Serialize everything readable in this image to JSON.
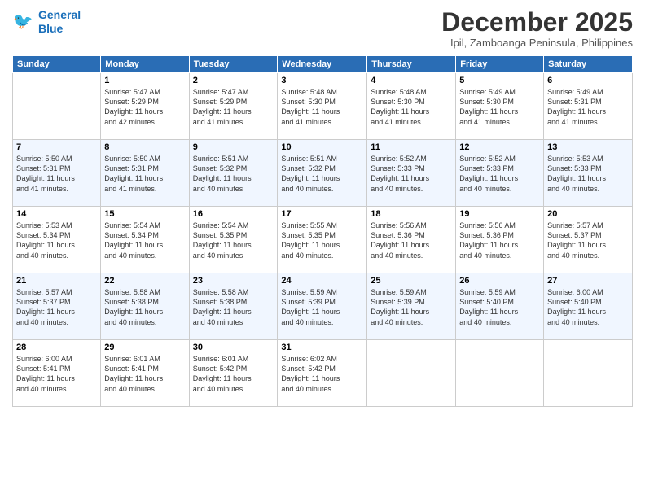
{
  "logo": {
    "line1": "General",
    "line2": "Blue"
  },
  "title": "December 2025",
  "location": "Ipil, Zamboanga Peninsula, Philippines",
  "days_of_week": [
    "Sunday",
    "Monday",
    "Tuesday",
    "Wednesday",
    "Thursday",
    "Friday",
    "Saturday"
  ],
  "weeks": [
    [
      {
        "day": "",
        "sunrise": "",
        "sunset": "",
        "daylight": ""
      },
      {
        "day": "1",
        "sunrise": "Sunrise: 5:47 AM",
        "sunset": "Sunset: 5:29 PM",
        "daylight": "Daylight: 11 hours and 42 minutes."
      },
      {
        "day": "2",
        "sunrise": "Sunrise: 5:47 AM",
        "sunset": "Sunset: 5:29 PM",
        "daylight": "Daylight: 11 hours and 41 minutes."
      },
      {
        "day": "3",
        "sunrise": "Sunrise: 5:48 AM",
        "sunset": "Sunset: 5:30 PM",
        "daylight": "Daylight: 11 hours and 41 minutes."
      },
      {
        "day": "4",
        "sunrise": "Sunrise: 5:48 AM",
        "sunset": "Sunset: 5:30 PM",
        "daylight": "Daylight: 11 hours and 41 minutes."
      },
      {
        "day": "5",
        "sunrise": "Sunrise: 5:49 AM",
        "sunset": "Sunset: 5:30 PM",
        "daylight": "Daylight: 11 hours and 41 minutes."
      },
      {
        "day": "6",
        "sunrise": "Sunrise: 5:49 AM",
        "sunset": "Sunset: 5:31 PM",
        "daylight": "Daylight: 11 hours and 41 minutes."
      }
    ],
    [
      {
        "day": "7",
        "sunrise": "Sunrise: 5:50 AM",
        "sunset": "Sunset: 5:31 PM",
        "daylight": "Daylight: 11 hours and 41 minutes."
      },
      {
        "day": "8",
        "sunrise": "Sunrise: 5:50 AM",
        "sunset": "Sunset: 5:31 PM",
        "daylight": "Daylight: 11 hours and 41 minutes."
      },
      {
        "day": "9",
        "sunrise": "Sunrise: 5:51 AM",
        "sunset": "Sunset: 5:32 PM",
        "daylight": "Daylight: 11 hours and 40 minutes."
      },
      {
        "day": "10",
        "sunrise": "Sunrise: 5:51 AM",
        "sunset": "Sunset: 5:32 PM",
        "daylight": "Daylight: 11 hours and 40 minutes."
      },
      {
        "day": "11",
        "sunrise": "Sunrise: 5:52 AM",
        "sunset": "Sunset: 5:33 PM",
        "daylight": "Daylight: 11 hours and 40 minutes."
      },
      {
        "day": "12",
        "sunrise": "Sunrise: 5:52 AM",
        "sunset": "Sunset: 5:33 PM",
        "daylight": "Daylight: 11 hours and 40 minutes."
      },
      {
        "day": "13",
        "sunrise": "Sunrise: 5:53 AM",
        "sunset": "Sunset: 5:33 PM",
        "daylight": "Daylight: 11 hours and 40 minutes."
      }
    ],
    [
      {
        "day": "14",
        "sunrise": "Sunrise: 5:53 AM",
        "sunset": "Sunset: 5:34 PM",
        "daylight": "Daylight: 11 hours and 40 minutes."
      },
      {
        "day": "15",
        "sunrise": "Sunrise: 5:54 AM",
        "sunset": "Sunset: 5:34 PM",
        "daylight": "Daylight: 11 hours and 40 minutes."
      },
      {
        "day": "16",
        "sunrise": "Sunrise: 5:54 AM",
        "sunset": "Sunset: 5:35 PM",
        "daylight": "Daylight: 11 hours and 40 minutes."
      },
      {
        "day": "17",
        "sunrise": "Sunrise: 5:55 AM",
        "sunset": "Sunset: 5:35 PM",
        "daylight": "Daylight: 11 hours and 40 minutes."
      },
      {
        "day": "18",
        "sunrise": "Sunrise: 5:56 AM",
        "sunset": "Sunset: 5:36 PM",
        "daylight": "Daylight: 11 hours and 40 minutes."
      },
      {
        "day": "19",
        "sunrise": "Sunrise: 5:56 AM",
        "sunset": "Sunset: 5:36 PM",
        "daylight": "Daylight: 11 hours and 40 minutes."
      },
      {
        "day": "20",
        "sunrise": "Sunrise: 5:57 AM",
        "sunset": "Sunset: 5:37 PM",
        "daylight": "Daylight: 11 hours and 40 minutes."
      }
    ],
    [
      {
        "day": "21",
        "sunrise": "Sunrise: 5:57 AM",
        "sunset": "Sunset: 5:37 PM",
        "daylight": "Daylight: 11 hours and 40 minutes."
      },
      {
        "day": "22",
        "sunrise": "Sunrise: 5:58 AM",
        "sunset": "Sunset: 5:38 PM",
        "daylight": "Daylight: 11 hours and 40 minutes."
      },
      {
        "day": "23",
        "sunrise": "Sunrise: 5:58 AM",
        "sunset": "Sunset: 5:38 PM",
        "daylight": "Daylight: 11 hours and 40 minutes."
      },
      {
        "day": "24",
        "sunrise": "Sunrise: 5:59 AM",
        "sunset": "Sunset: 5:39 PM",
        "daylight": "Daylight: 11 hours and 40 minutes."
      },
      {
        "day": "25",
        "sunrise": "Sunrise: 5:59 AM",
        "sunset": "Sunset: 5:39 PM",
        "daylight": "Daylight: 11 hours and 40 minutes."
      },
      {
        "day": "26",
        "sunrise": "Sunrise: 5:59 AM",
        "sunset": "Sunset: 5:40 PM",
        "daylight": "Daylight: 11 hours and 40 minutes."
      },
      {
        "day": "27",
        "sunrise": "Sunrise: 6:00 AM",
        "sunset": "Sunset: 5:40 PM",
        "daylight": "Daylight: 11 hours and 40 minutes."
      }
    ],
    [
      {
        "day": "28",
        "sunrise": "Sunrise: 6:00 AM",
        "sunset": "Sunset: 5:41 PM",
        "daylight": "Daylight: 11 hours and 40 minutes."
      },
      {
        "day": "29",
        "sunrise": "Sunrise: 6:01 AM",
        "sunset": "Sunset: 5:41 PM",
        "daylight": "Daylight: 11 hours and 40 minutes."
      },
      {
        "day": "30",
        "sunrise": "Sunrise: 6:01 AM",
        "sunset": "Sunset: 5:42 PM",
        "daylight": "Daylight: 11 hours and 40 minutes."
      },
      {
        "day": "31",
        "sunrise": "Sunrise: 6:02 AM",
        "sunset": "Sunset: 5:42 PM",
        "daylight": "Daylight: 11 hours and 40 minutes."
      },
      {
        "day": "",
        "sunrise": "",
        "sunset": "",
        "daylight": ""
      },
      {
        "day": "",
        "sunrise": "",
        "sunset": "",
        "daylight": ""
      },
      {
        "day": "",
        "sunrise": "",
        "sunset": "",
        "daylight": ""
      }
    ]
  ]
}
